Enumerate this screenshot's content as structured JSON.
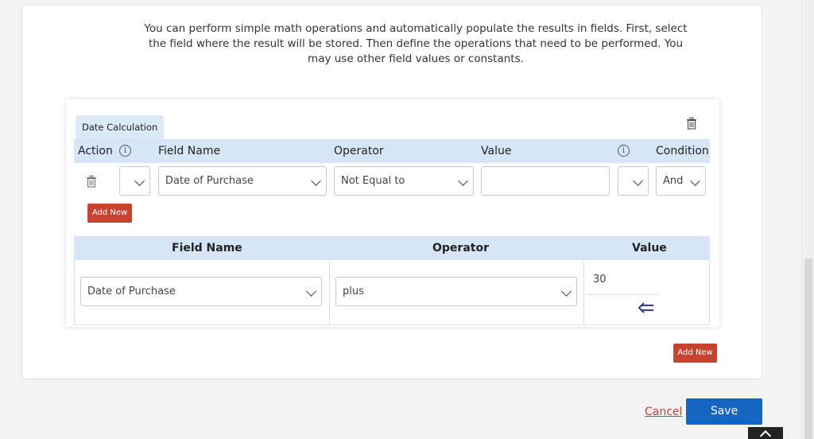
{
  "intro": {
    "text": "You can perform simple math operations and automatically populate the results in fields. First, select the field where the result will be stored. Then define the operations that need to be performed. You may use other field values or constants."
  },
  "panel": {
    "tab_label": "Date Calculation",
    "condition_header": {
      "action": "Action",
      "field_name": "Field Name",
      "operator": "Operator",
      "value": "Value",
      "condition": "Condition"
    },
    "condition_row": {
      "action_value": "",
      "field_name": "Date of Purchase",
      "operator": "Not Equal to",
      "value": "",
      "extra_value": "",
      "condition": "And"
    },
    "add_new_label": "Add New",
    "calc_header": {
      "field_name": "Field Name",
      "operator": "Operator",
      "value": "Value"
    },
    "calc_row": {
      "field_name": "Date of Purchase",
      "operator": "plus",
      "value": "30"
    }
  },
  "outer_add_new_label": "Add New",
  "footer": {
    "cancel_label": "Cancel",
    "save_label": "Save"
  },
  "icons": [
    "trash-icon",
    "info-icon",
    "chevron-down-icon",
    "left-arrow-icon",
    "scroll-to-top-icon"
  ],
  "colors": {
    "accent_blue": "#1665c1",
    "danger_red": "#c6432f",
    "header_blue": "#d6e6f7"
  }
}
